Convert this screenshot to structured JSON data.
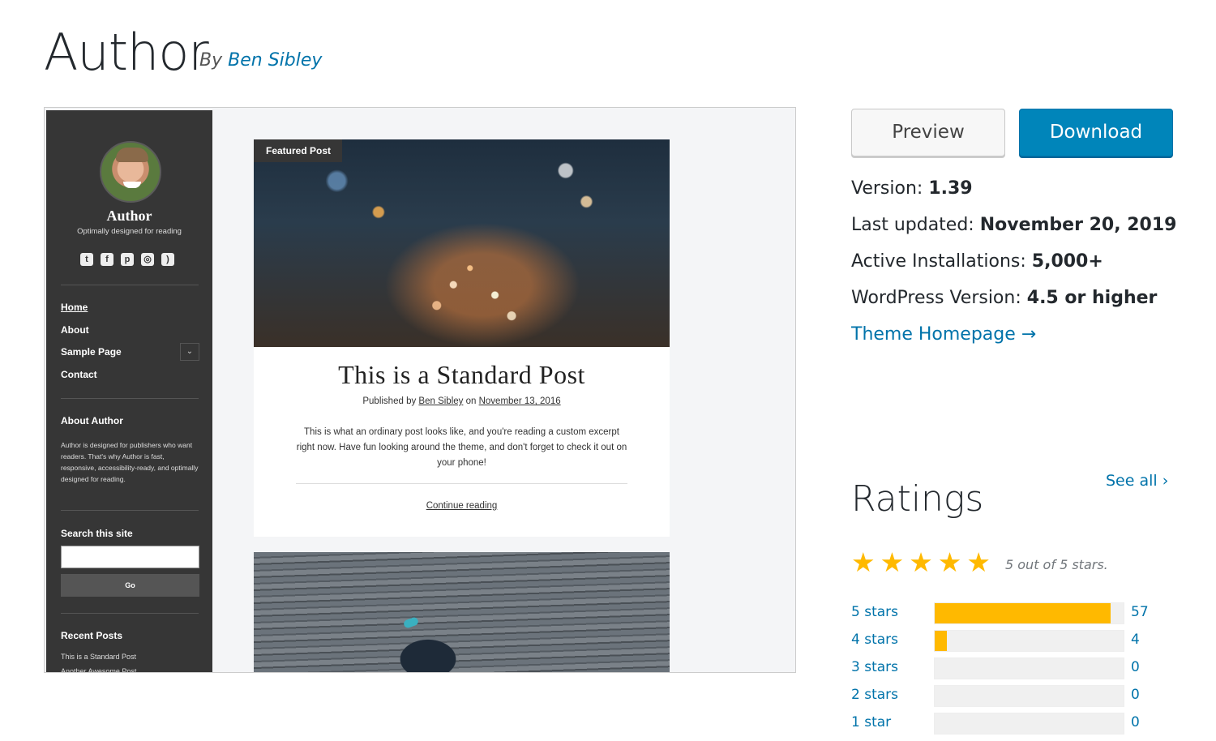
{
  "header": {
    "title": "Author",
    "by_prefix": "By",
    "author": "Ben Sibley"
  },
  "screenshot": {
    "sidebar": {
      "site_name": "Author",
      "tagline": "Optimally designed for reading",
      "social_icons": [
        "twitter-icon",
        "facebook-icon",
        "pinterest-icon",
        "instagram-icon",
        "rss-icon"
      ],
      "nav": [
        "Home",
        "About",
        "Sample Page",
        "Contact"
      ],
      "about_heading": "About Author",
      "about_text": "Author is designed for publishers who want readers. That's why Author is fast, responsive, accessibility-ready, and optimally designed for reading.",
      "search_heading": "Search this site",
      "search_button": "Go",
      "recent_heading": "Recent Posts",
      "recent_posts": [
        "This is a Standard Post",
        "Another Awesome Post"
      ]
    },
    "post": {
      "badge": "Featured Post",
      "title": "This is a Standard Post",
      "meta_prefix": "Published by",
      "meta_author": "Ben Sibley",
      "meta_on": "on",
      "meta_date": "November 13, 2016",
      "excerpt": "This is what an ordinary post looks like, and you're reading a custom excerpt right now. Have fun looking around the theme, and don't forget to check it out on your phone!",
      "continue": "Continue reading"
    }
  },
  "actions": {
    "preview": "Preview",
    "download": "Download"
  },
  "details": {
    "version_label": "Version:",
    "version": "1.39",
    "updated_label": "Last updated:",
    "updated": "November 20, 2019",
    "installs_label": "Active Installations:",
    "installs": "5,000+",
    "wp_label": "WordPress Version:",
    "wp": "4.5 or higher",
    "homepage": "Theme Homepage →"
  },
  "ratings": {
    "heading": "Ratings",
    "see_all": "See all ›",
    "stars_text": "5 out of 5 stars.",
    "average": 5,
    "rows": [
      {
        "label": "5 stars",
        "count": "57",
        "fraction": 0.93
      },
      {
        "label": "4 stars",
        "count": "4",
        "fraction": 0.065
      },
      {
        "label": "3 stars",
        "count": "0",
        "fraction": 0
      },
      {
        "label": "2 stars",
        "count": "0",
        "fraction": 0
      },
      {
        "label": "1 star",
        "count": "0",
        "fraction": 0
      }
    ]
  },
  "colors": {
    "link": "#0073aa",
    "download_bg": "#0085ba",
    "star": "#ffb900",
    "sidebar_bg": "#363636"
  }
}
